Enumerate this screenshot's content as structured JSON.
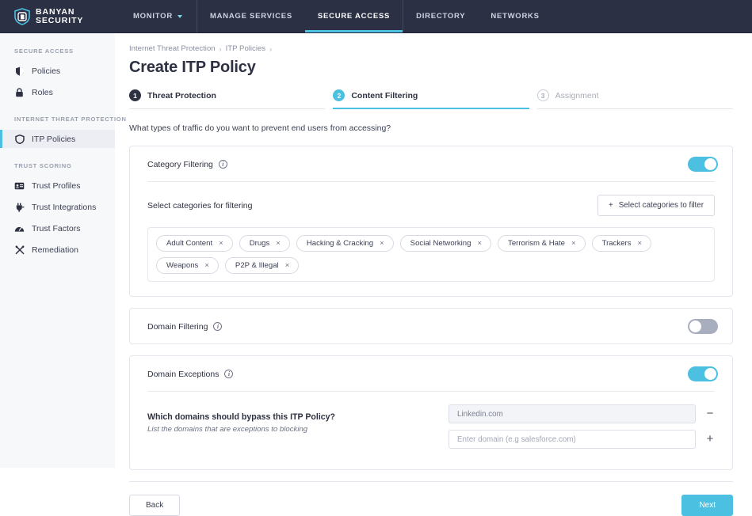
{
  "brand": {
    "line1": "BANYAN",
    "line2": "SECURITY",
    "logo_icon": "shield-b-logo"
  },
  "topnav": {
    "items": [
      {
        "label": "MONITOR",
        "active": false,
        "caret": true
      },
      {
        "label": "MANAGE SERVICES",
        "active": false,
        "caret": false
      },
      {
        "label": "SECURE ACCESS",
        "active": true,
        "caret": false
      },
      {
        "label": "DIRECTORY",
        "active": false,
        "caret": false
      },
      {
        "label": "NETWORKS",
        "active": false,
        "caret": false
      }
    ],
    "accent_color": "#4bc0e0",
    "background": "#2b3045"
  },
  "sidebar": {
    "groups": [
      {
        "label": "SECURE ACCESS",
        "items": [
          {
            "label": "Policies",
            "icon": "policy-shield-icon",
            "selected": false
          },
          {
            "label": "Roles",
            "icon": "lock-icon",
            "selected": false
          }
        ]
      },
      {
        "label": "INTERNET THREAT PROTECTION",
        "items": [
          {
            "label": "ITP Policies",
            "icon": "shield-icon",
            "selected": true
          }
        ]
      },
      {
        "label": "TRUST SCORING",
        "items": [
          {
            "label": "Trust Profiles",
            "icon": "id-card-icon",
            "selected": false
          },
          {
            "label": "Trust Integrations",
            "icon": "plug-icon",
            "selected": false
          },
          {
            "label": "Trust Factors",
            "icon": "gauge-icon",
            "selected": false
          },
          {
            "label": "Remediation",
            "icon": "tools-icon",
            "selected": false
          }
        ]
      }
    ]
  },
  "breadcrumb": {
    "crumbs": [
      "Internet Threat Protection",
      "ITP Policies"
    ],
    "separator": "›",
    "trailing_separator": "›"
  },
  "page": {
    "title": "Create ITP Policy",
    "prompt": "What types of traffic do you want to prevent end users from accessing?"
  },
  "stepper": {
    "steps": [
      {
        "num": "1",
        "label": "Threat Protection",
        "state": "done"
      },
      {
        "num": "2",
        "label": "Content Filtering",
        "state": "active"
      },
      {
        "num": "3",
        "label": "Assignment",
        "state": "todo"
      }
    ]
  },
  "category_filtering": {
    "title": "Category Filtering",
    "info_icon": "info-icon",
    "toggle_state": "on",
    "select_label": "Select categories for filtering",
    "select_button": {
      "label": "Select categories to filter",
      "icon": "plus-icon"
    },
    "chips": [
      "Adult Content",
      "Drugs",
      "Hacking & Cracking",
      "Social Networking",
      "Terrorism & Hate",
      "Trackers",
      "Weapons",
      "P2P & Illegal"
    ],
    "chip_remove_icon": "×"
  },
  "domain_filtering": {
    "title": "Domain Filtering",
    "info_icon": "info-icon",
    "toggle_state": "off"
  },
  "domain_exceptions": {
    "title": "Domain Exceptions",
    "info_icon": "info-icon",
    "toggle_state": "on",
    "question": "Which domains should bypass this ITP Policy?",
    "subtext": "List the domains that are exceptions to blocking",
    "rows": [
      {
        "value": "Linkedin.com",
        "placeholder": "",
        "button": "−",
        "button_name": "remove-domain-button"
      },
      {
        "value": "",
        "placeholder": "Enter domain (e.g salesforce.com)",
        "button": "+",
        "button_name": "add-domain-button"
      }
    ]
  },
  "footer": {
    "back_label": "Back",
    "next_label": "Next",
    "next_color": "#4bc0e0"
  }
}
